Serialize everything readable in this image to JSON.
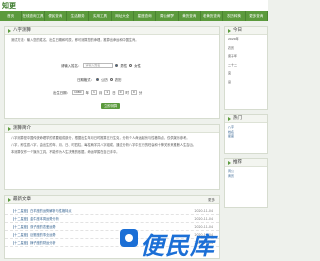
{
  "header": {
    "logo": "知更"
  },
  "nav": [
    "首页",
    "在线查询工具",
    "便民查询",
    "生活服务",
    "实用工具",
    "网址大全",
    "星座查询",
    "周公解梦",
    "黄历查询",
    "老黄历查询",
    "农历转换",
    "更多查询"
  ],
  "main": {
    "title": "八字测算",
    "intro": "测试方法：输入您的姓名、出生日期和时辰，即可测算您的命理，推算出命运和中国生肖。",
    "form": {
      "name_label": "请输入姓名：",
      "name_placeholder": "请输入姓名",
      "male": "男性",
      "female": "女性",
      "calendar_label": "日期格式：",
      "solar": "公历",
      "lunar": "农历",
      "birth_label": "出生日期：",
      "year": "1980",
      "year_unit": "年",
      "month": "1",
      "month_unit": "月",
      "day": "1",
      "day_unit": "日",
      "hour": "0",
      "hour_unit": "时",
      "minute": "0",
      "minute_unit": "分",
      "submit": "立即测算"
    }
  },
  "about": {
    "title": "测算简介",
    "p1": "八字测算是中国传统命理学的重要组成部分，根据出生年月日时推算五行生克，分析个人命运起伏与性格特点，仅供娱乐参考。",
    "p2": "八字，即生辰八字，由出生的年、月、日、时四柱，每柱两字共八字组成，通过分析八字中五行的旺衰和十神关系来推断人生吉凶。",
    "p3": "本测算仅作一个娱乐工具，不能作为人生决策的依据，命运掌握在自己手中。"
  },
  "list": {
    "title": "最新文章",
    "more": "更多",
    "items": [
      {
        "title": "【十二星座】白羊座的运势解析与性格特点",
        "date": "2020-11-04"
      },
      {
        "title": "【十二星座】金牛座本周运势分析",
        "date": "2020-11-04"
      },
      {
        "title": "【十二星座】双子座的恋爱运势",
        "date": "2020-11-04"
      },
      {
        "title": "【十二星座】巨蟹座的事业运势",
        "date": "2020-11-04"
      },
      {
        "title": "【十二星座】狮子座的财运分析",
        "date": "2020-11-04"
      }
    ]
  },
  "sidebar": {
    "today_title": "今日",
    "today_lines": [
      "2020年",
      "农历",
      "庚子年",
      "二十二",
      "宜",
      "忌"
    ],
    "tools_title": "热门",
    "tools": [
      "八字",
      "姓名",
      "星座"
    ],
    "hot_title": "推荐",
    "hot": [
      "周公",
      "黄历"
    ]
  },
  "watermark": {
    "text": "便民库"
  },
  "colors": {
    "nav": "#5b9a3c",
    "accent": "#1b6fd6"
  }
}
